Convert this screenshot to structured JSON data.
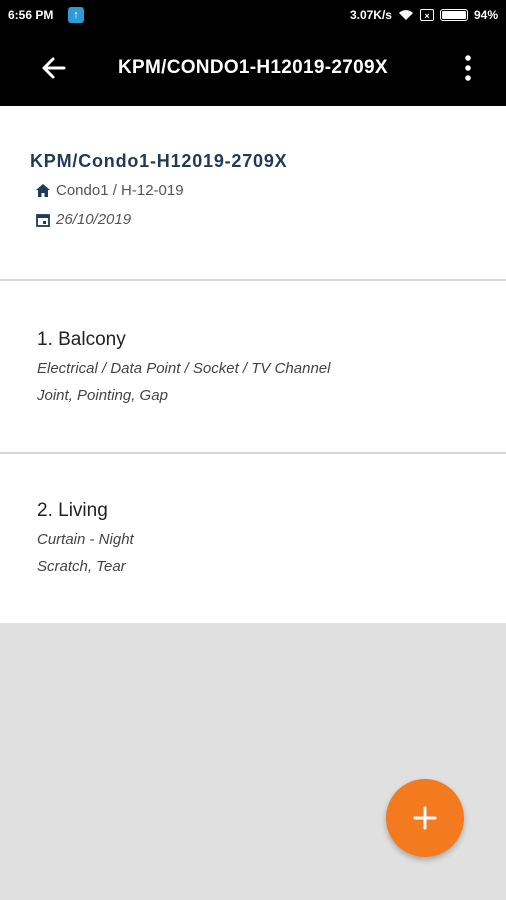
{
  "status_bar": {
    "time": "6:56 PM",
    "network_speed": "3.07K/s",
    "battery": "94%",
    "icons": [
      "notification-upload-icon",
      "wifi-icon",
      "sim-icon",
      "battery-icon"
    ]
  },
  "app_bar": {
    "title": "KPM/CONDO1-H12019-2709X",
    "back_icon": "arrow-back-icon",
    "menu_icon": "more-vert-icon"
  },
  "header": {
    "reference": "KPM/Condo1-H12019-2709X",
    "location": "Condo1 / H-12-019",
    "date": "26/10/2019"
  },
  "items": [
    {
      "title": "1. Balcony",
      "category": "Electrical / Data Point / Socket / TV Channel",
      "defects": "Joint, Pointing, Gap"
    },
    {
      "title": "2. Living",
      "category": "Curtain - Night",
      "defects": "Scratch, Tear"
    }
  ],
  "fab": {
    "icon": "add-icon"
  },
  "colors": {
    "app_bar": "#000000",
    "accent": "#f47a20",
    "reference_text": "#1f3b57",
    "background": "#e0e0e0"
  }
}
